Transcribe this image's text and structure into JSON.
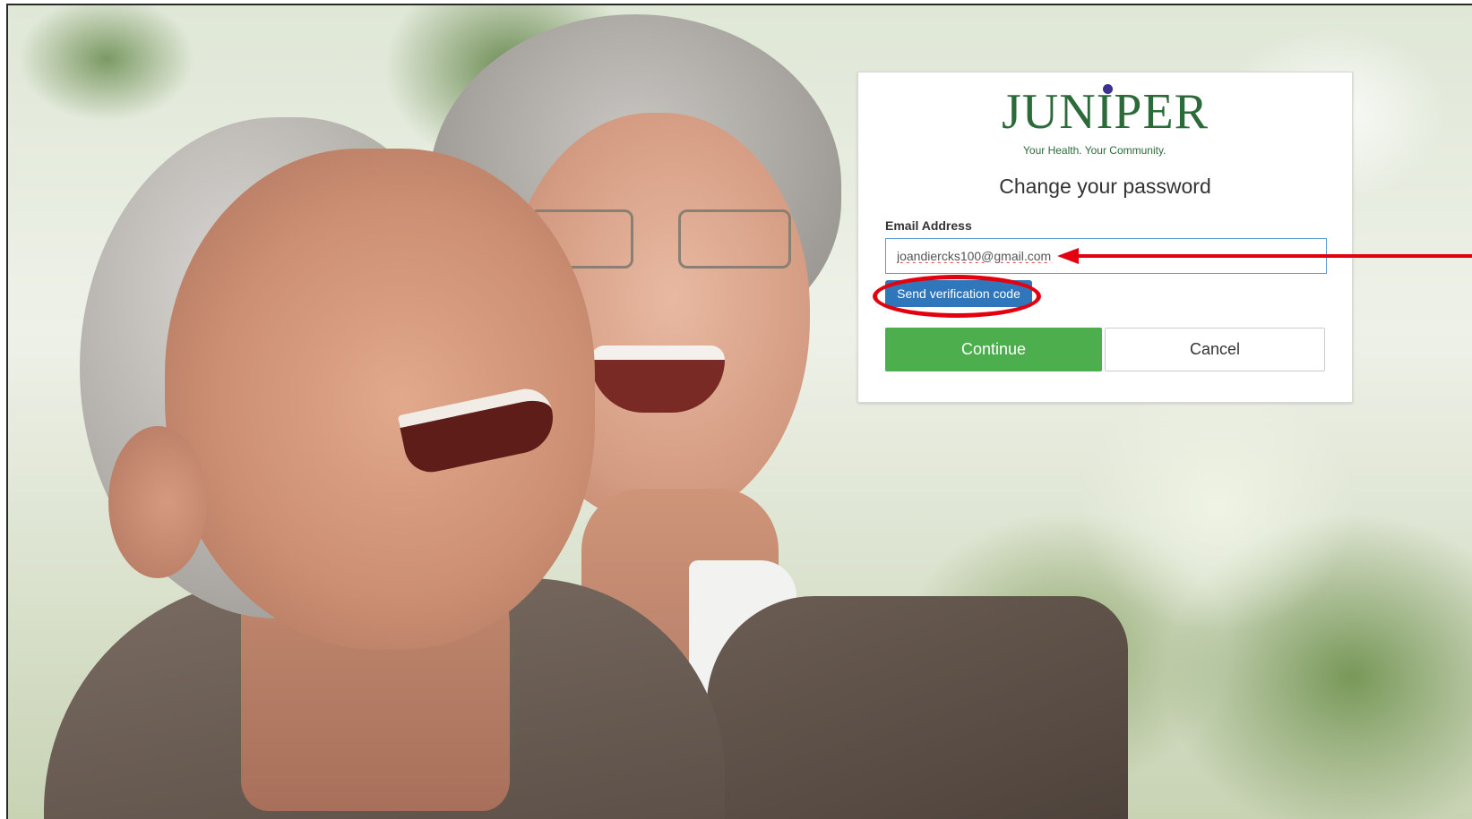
{
  "brand": {
    "logo_word": "JUNIPER",
    "tagline": "Your Health. Your Community.",
    "primary_color": "#2c6a3a",
    "dot_color": "#3b2f8f"
  },
  "form": {
    "heading": "Change your password",
    "email_label": "Email Address",
    "email_value": "joandiercks100@gmail.com",
    "send_code_label": "Send verification code",
    "continue_label": "Continue",
    "cancel_label": "Cancel"
  },
  "colors": {
    "send_button": "#2f77ba",
    "continue_button": "#4cae4c",
    "annotation": "#e3000f"
  },
  "annotations": {
    "highlight_target": "send-verification-code-button",
    "arrow_target": "email-address-input"
  }
}
